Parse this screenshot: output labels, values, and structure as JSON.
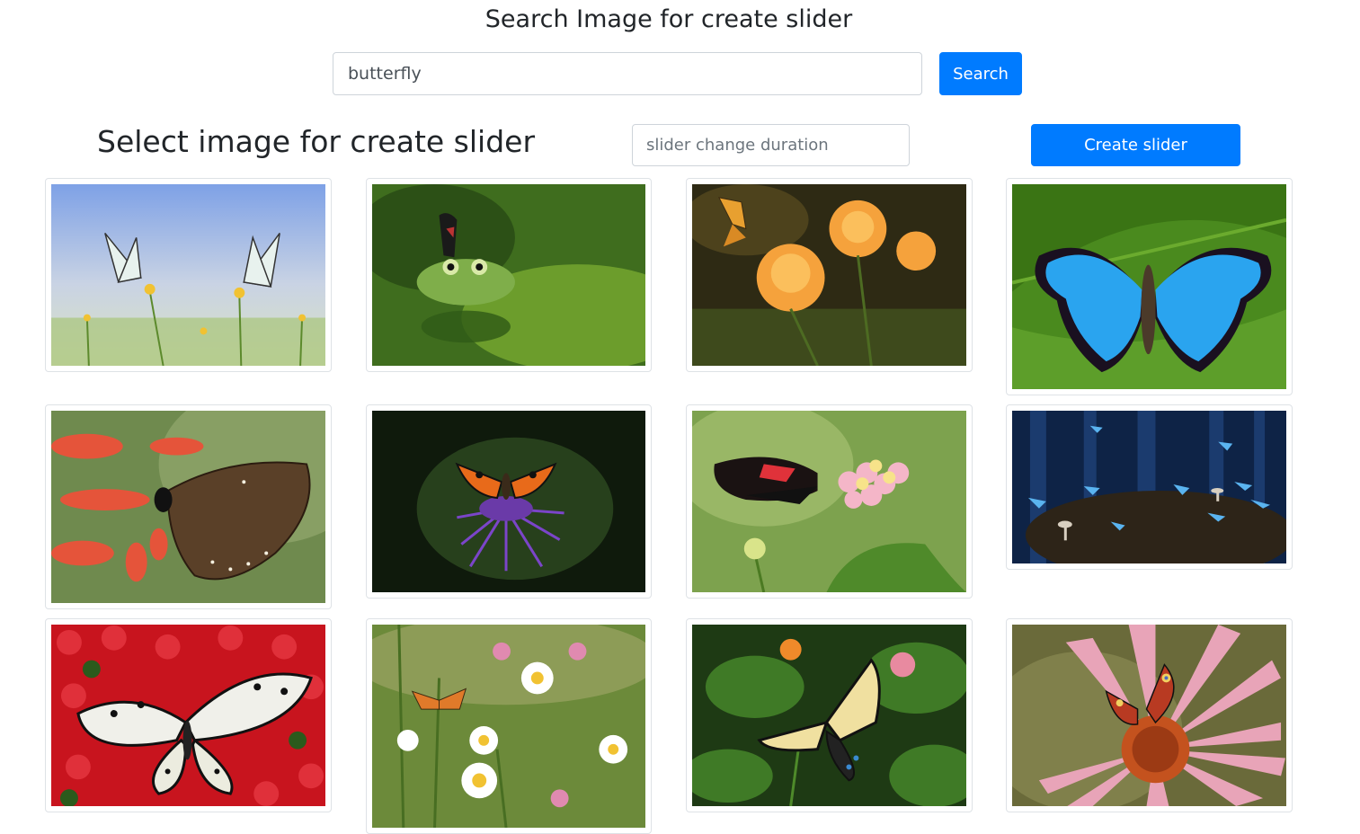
{
  "header": {
    "title": "Search Image for create slider"
  },
  "search": {
    "value": "butterfly",
    "button_label": "Search"
  },
  "slider": {
    "heading": "Select image for create slider",
    "duration_placeholder": "slider change duration",
    "create_label": "Create slider"
  },
  "gallery": {
    "images": [
      {
        "subject": "white-butterflies-meadow"
      },
      {
        "subject": "butterfly-on-frog"
      },
      {
        "subject": "fritillary-orange-flowers"
      },
      {
        "subject": "blue-morpho-leaf"
      },
      {
        "subject": "brown-butterfly-red-flowers"
      },
      {
        "subject": "tortoiseshell-thistle"
      },
      {
        "subject": "postman-butterfly-lantana"
      },
      {
        "subject": "blue-butterflies-forest"
      },
      {
        "subject": "paper-kite-red-flowers"
      },
      {
        "subject": "fritillary-daisies"
      },
      {
        "subject": "swallowtail-green-leaves"
      },
      {
        "subject": "peacock-echinacea"
      }
    ]
  }
}
